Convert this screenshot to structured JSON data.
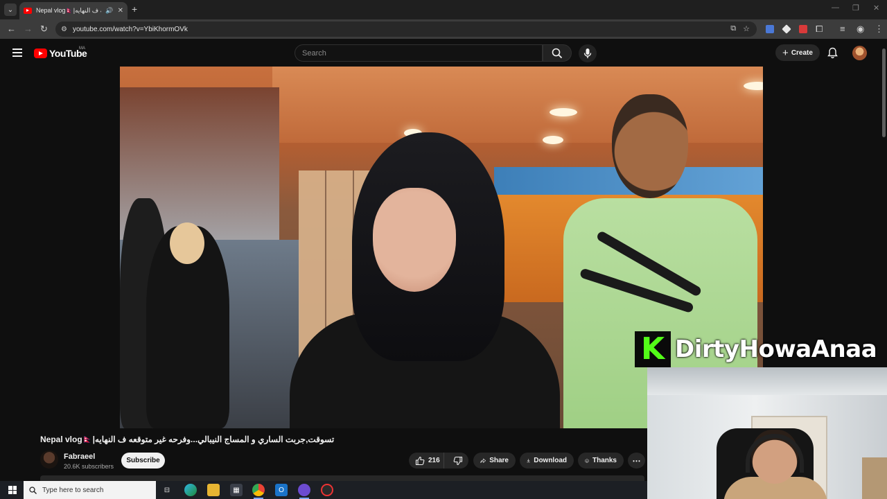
{
  "browser": {
    "tab": {
      "title": "Nepal vlog🇳🇵|تسوقت,جربت الساري و المساج النيبالي...وفرحه غير متوقعه ف النهايه"
    },
    "url": "youtube.com/watch?v=YbiKhormOVk"
  },
  "youtube": {
    "logo_text": "YouTube",
    "country_code": "MA",
    "search_placeholder": "Search",
    "create_label": "Create"
  },
  "video": {
    "title": "Nepal vlog🇳🇵|تسوقت,جربت الساري و المساج النيبالي...وفرحه غير متوقعه ف النهايه",
    "channel_name": "Fabraeel",
    "subscribers": "20.6K subscribers",
    "subscribe_label": "Subscribe",
    "likes": "216",
    "share_label": "Share",
    "download_label": "Download",
    "thanks_label": "Thanks"
  },
  "overlay": {
    "logo_letter": "K",
    "streamer_name": "DirtyHowaAnaa"
  },
  "taskbar": {
    "search_placeholder": "Type here to search"
  },
  "colors": {
    "youtube_red": "#ff0000",
    "kick_green": "#53fc18",
    "background": "#0f0f0f"
  }
}
